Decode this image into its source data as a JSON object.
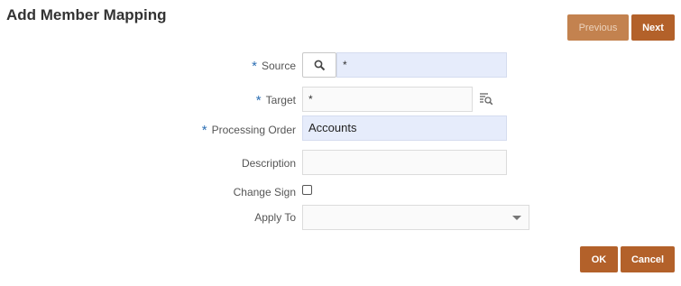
{
  "dialog": {
    "title": "Add Member Mapping"
  },
  "nav": {
    "previous_label": "Previous",
    "next_label": "Next"
  },
  "form": {
    "required_marker": "*",
    "source": {
      "label": "Source",
      "value": "*",
      "search_icon": "search-icon"
    },
    "target": {
      "label": "Target",
      "value": "*",
      "lookup_icon": "list-search-icon"
    },
    "processing_order": {
      "label": "Processing Order",
      "value": "Accounts"
    },
    "description": {
      "label": "Description",
      "value": ""
    },
    "change_sign": {
      "label": "Change Sign",
      "checked": false
    },
    "apply_to": {
      "label": "Apply To",
      "value": ""
    }
  },
  "footer": {
    "ok_label": "OK",
    "cancel_label": "Cancel"
  },
  "colors": {
    "accent": "#b3612a",
    "required": "#2d6fb4",
    "highlight_field": "#e6ecfb"
  }
}
